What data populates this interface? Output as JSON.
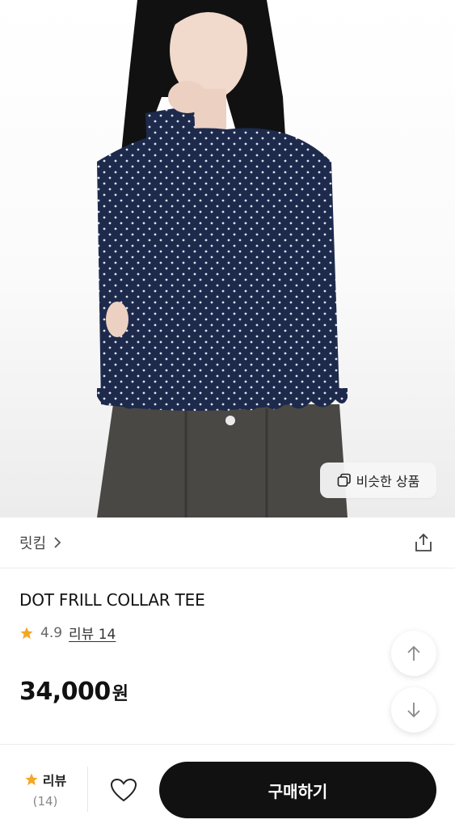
{
  "product_image": {
    "alt": ""
  },
  "similar_button": {
    "label": "비슷한 상품"
  },
  "brand": {
    "name": "릿킴"
  },
  "product": {
    "title": "DOT FRILL COLLAR TEE",
    "rating": "4.9",
    "review_link": "리뷰 14",
    "price": "34,000",
    "currency": "원"
  },
  "bottom_bar": {
    "review_label": "리뷰",
    "review_count": "(14)",
    "buy_label": "구매하기"
  },
  "colors": {
    "star": "#F5A623",
    "buy_button": "#111111",
    "dot_blouse": "#1B2A4E"
  },
  "icons": [
    "copy-icon",
    "chevron-right-icon",
    "share-icon",
    "star-icon",
    "arrow-up-icon",
    "arrow-down-icon",
    "heart-icon"
  ]
}
